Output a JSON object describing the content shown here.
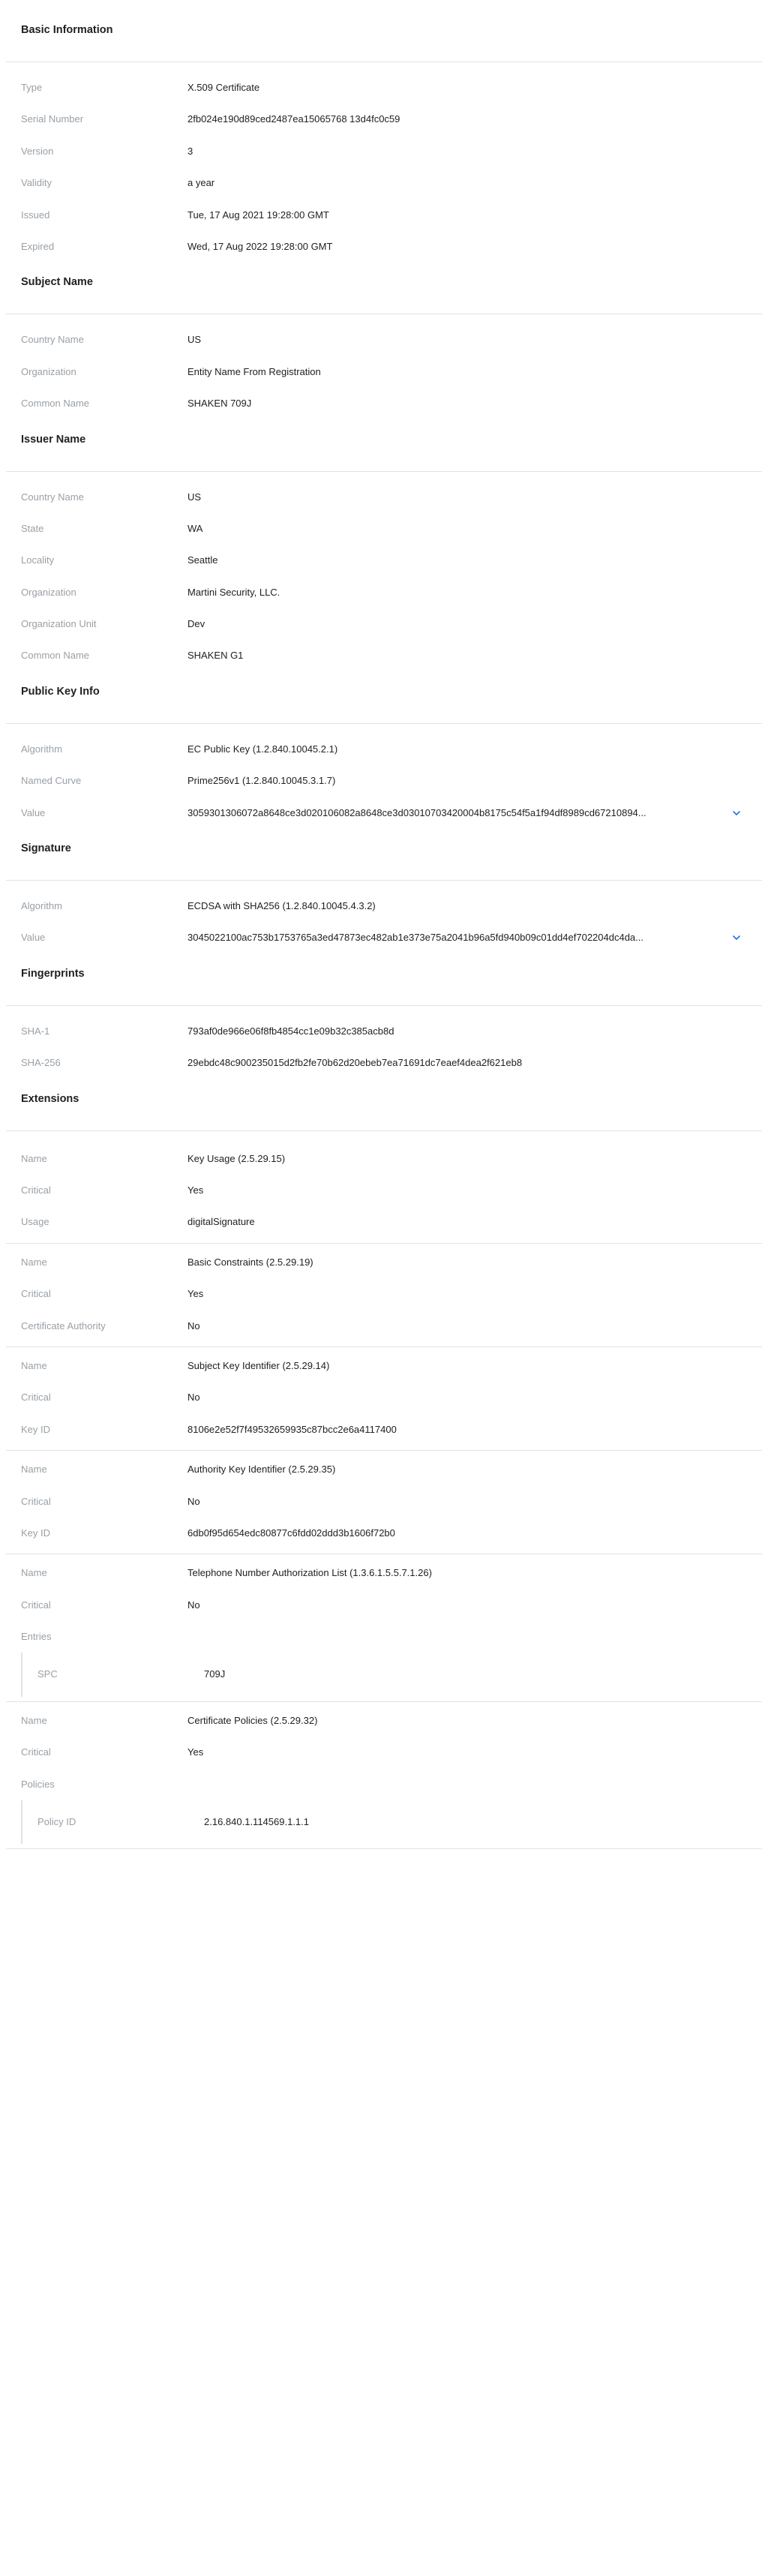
{
  "sections": {
    "basic": {
      "title": "Basic Information",
      "rows": [
        {
          "label": "Type",
          "value": "X.509 Certificate"
        },
        {
          "label": "Serial Number",
          "value": "2fb024e190d89ced2487ea15065768 13d4fc0c59"
        },
        {
          "label": "Version",
          "value": "3"
        },
        {
          "label": "Validity",
          "value": "a year"
        },
        {
          "label": "Issued",
          "value": "Tue, 17 Aug 2021 19:28:00 GMT"
        },
        {
          "label": "Expired",
          "value": "Wed, 17 Aug 2022 19:28:00 GMT"
        }
      ]
    },
    "subject": {
      "title": "Subject Name",
      "rows": [
        {
          "label": "Country Name",
          "value": "US"
        },
        {
          "label": "Organization",
          "value": "Entity Name From Registration"
        },
        {
          "label": "Common Name",
          "value": "SHAKEN 709J"
        }
      ]
    },
    "issuer": {
      "title": "Issuer Name",
      "rows": [
        {
          "label": "Country Name",
          "value": "US"
        },
        {
          "label": "State",
          "value": "WA"
        },
        {
          "label": "Locality",
          "value": "Seattle"
        },
        {
          "label": "Organization",
          "value": "Martini Security, LLC."
        },
        {
          "label": "Organization Unit",
          "value": "Dev"
        },
        {
          "label": "Common Name",
          "value": "SHAKEN G1"
        }
      ]
    },
    "pubkey": {
      "title": "Public Key Info",
      "rows": [
        {
          "label": "Algorithm",
          "value": "EC Public Key (1.2.840.10045.2.1)"
        },
        {
          "label": "Named Curve",
          "value": "Prime256v1 (1.2.840.10045.3.1.7)"
        },
        {
          "label": "Value",
          "value": "3059301306072a8648ce3d020106082a8648ce3d03010703420004b8175c54f5a1f94df8989cd67210894..."
        }
      ]
    },
    "signature": {
      "title": "Signature",
      "rows": [
        {
          "label": "Algorithm",
          "value": "ECDSA with SHA256 (1.2.840.10045.4.3.2)"
        },
        {
          "label": "Value",
          "value": "3045022100ac753b1753765a3ed47873ec482ab1e373e75a2041b96a5fd940b09c01dd4ef702204dc4da..."
        }
      ]
    },
    "fingerprints": {
      "title": "Fingerprints",
      "rows": [
        {
          "label": "SHA-1",
          "value": "793af0de966e06f8fb4854cc1e09b32c385acb8d"
        },
        {
          "label": "SHA-256",
          "value": "29ebdc48c900235015d2fb2fe70b62d20ebeb7ea71691dc7eaef4dea2f621eb8"
        }
      ]
    },
    "extensions": {
      "title": "Extensions",
      "groups": [
        {
          "rows": [
            {
              "label": "Name",
              "value": "Key Usage (2.5.29.15)"
            },
            {
              "label": "Critical",
              "value": "Yes"
            },
            {
              "label": "Usage",
              "value": "digitalSignature"
            }
          ]
        },
        {
          "rows": [
            {
              "label": "Name",
              "value": "Basic Constraints (2.5.29.19)"
            },
            {
              "label": "Critical",
              "value": "Yes"
            },
            {
              "label": "Certificate Authority",
              "value": "No"
            }
          ]
        },
        {
          "rows": [
            {
              "label": "Name",
              "value": "Subject Key Identifier (2.5.29.14)"
            },
            {
              "label": "Critical",
              "value": "No"
            },
            {
              "label": "Key ID",
              "value": "8106e2e52f7f49532659935c87bcc2e6a4117400"
            }
          ]
        },
        {
          "rows": [
            {
              "label": "Name",
              "value": "Authority Key Identifier (2.5.29.35)"
            },
            {
              "label": "Critical",
              "value": "No"
            },
            {
              "label": "Key ID",
              "value": "6db0f95d654edc80877c6fdd02ddd3b1606f72b0"
            }
          ]
        },
        {
          "rows": [
            {
              "label": "Name",
              "value": "Telephone Number Authorization List (1.3.6.1.5.5.7.1.26)"
            },
            {
              "label": "Critical",
              "value": "No"
            },
            {
              "label": "Entries",
              "value": ""
            }
          ],
          "nested": [
            {
              "label": "SPC",
              "value": "709J"
            }
          ]
        },
        {
          "rows": [
            {
              "label": "Name",
              "value": "Certificate Policies (2.5.29.32)"
            },
            {
              "label": "Critical",
              "value": "Yes"
            },
            {
              "label": "Policies",
              "value": ""
            }
          ],
          "nested": [
            {
              "label": "Policy ID",
              "value": "2.16.840.1.114569.1.1.1"
            }
          ]
        }
      ]
    }
  },
  "icons": {
    "expand": "chevron-down-icon"
  },
  "colors": {
    "accent": "#1a73e8",
    "label": "#9aa0a6",
    "divider": "#e3e3e3"
  }
}
